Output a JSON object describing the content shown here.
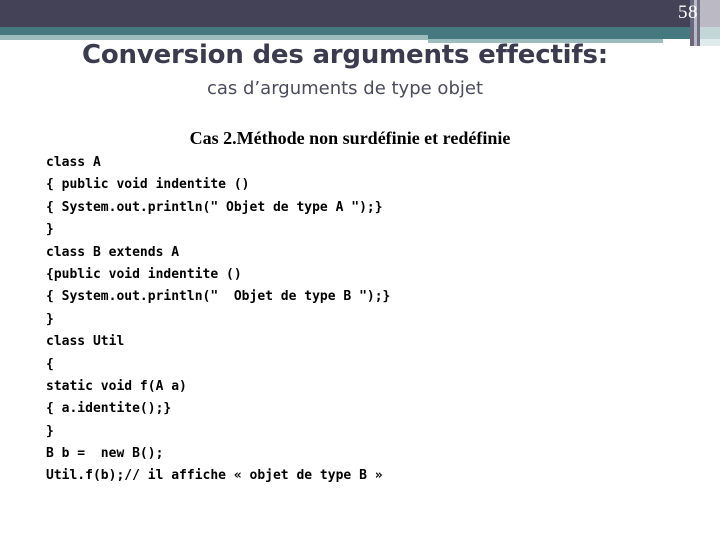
{
  "header": {
    "slide_number": "58",
    "colors": {
      "band_dark": "#434256",
      "band_teal": "#45797f",
      "band_light_teal": "#9dbcbd",
      "stripe_lavender": "#bab9c4",
      "title_text": "#3b3b50"
    }
  },
  "slide": {
    "title": "Conversion des arguments effectifs:",
    "subtitle": "cas d’arguments de type objet",
    "section_heading": "Cas 2.Méthode non surdéfinie et redéfinie"
  },
  "code": {
    "language": "java",
    "lines": [
      "class A",
      "{ public void indentite ()",
      "{ System.out.println(\" Objet de type A \");}",
      "}",
      "class B extends A",
      "{public void indentite ()",
      "{ System.out.println(\"  Objet de type B \");}",
      "}",
      "class Util",
      "{",
      "static void f(A a)",
      "{ a.identite();}",
      "}",
      "B b =  new B();",
      "Util.f(b);// il affiche « objet de type B »"
    ]
  }
}
